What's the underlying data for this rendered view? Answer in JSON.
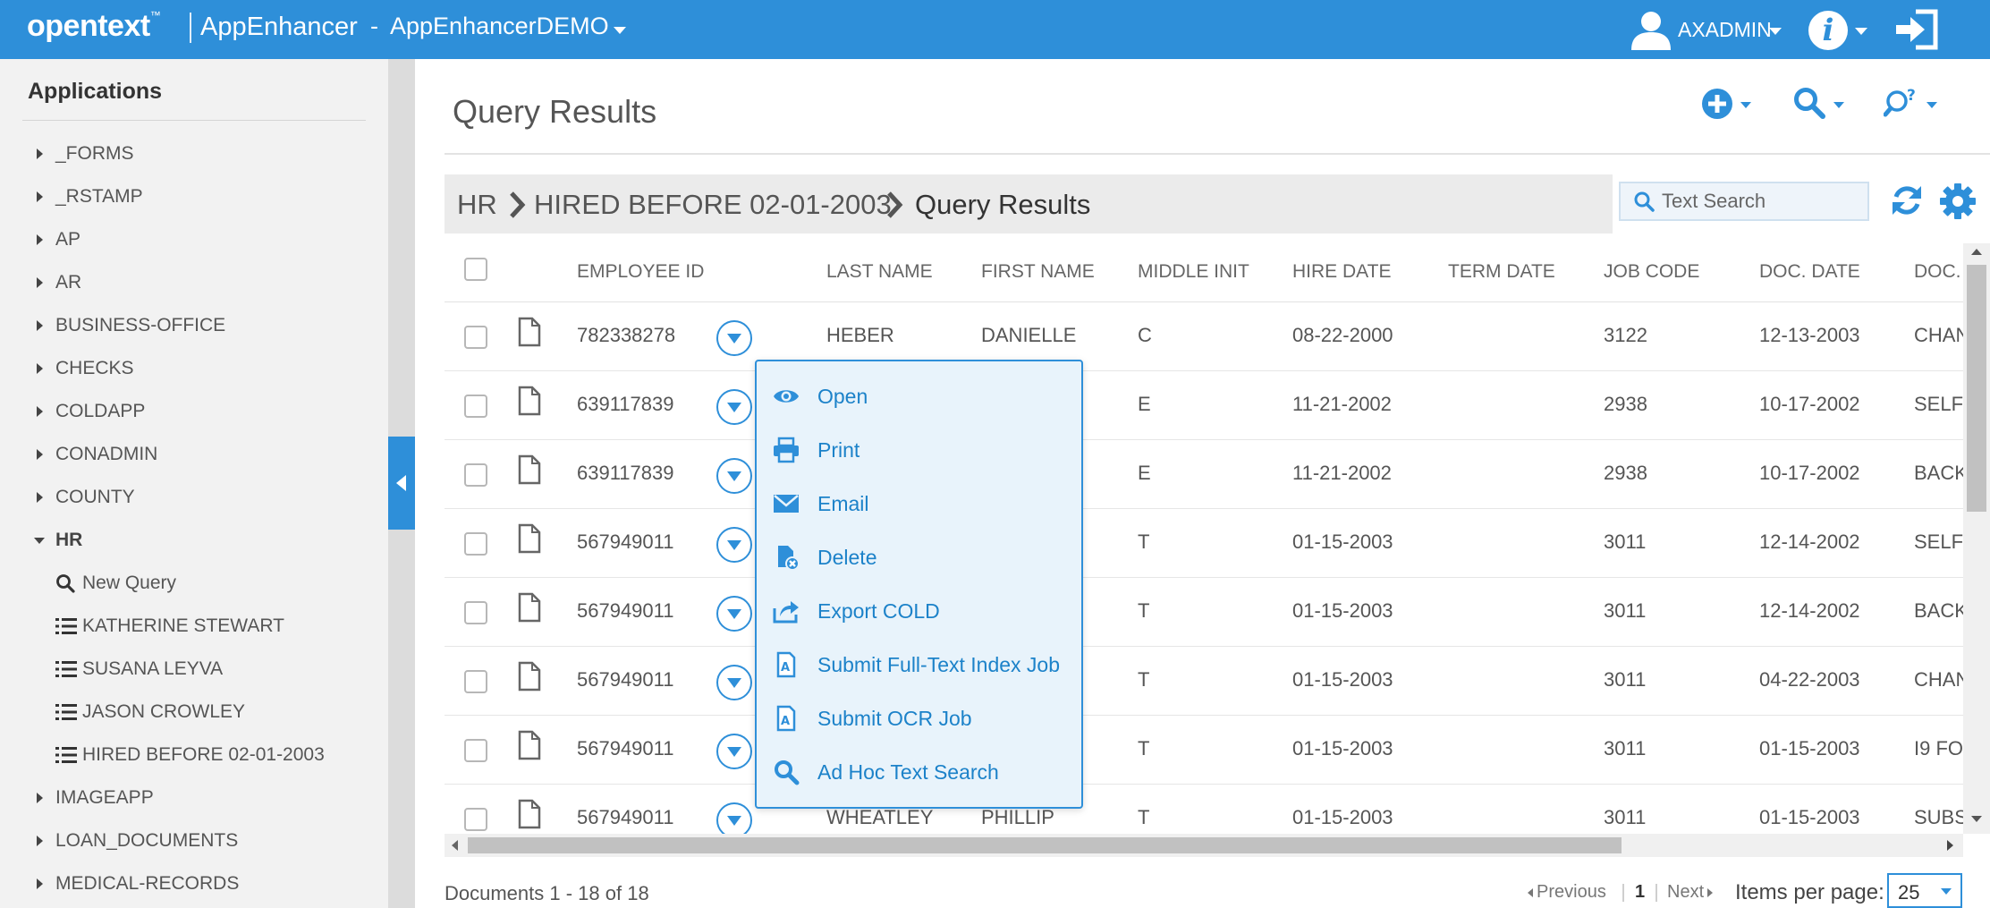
{
  "header": {
    "brand": "opentext",
    "brand_tm": "™",
    "app_name": "AppEnhancer",
    "separator": "-",
    "app_instance": "AppEnhancerDEMO",
    "user_name": "AXADMIN",
    "info_icon_glyph": "i",
    "accent_color": "#2e8fd9"
  },
  "sidebar": {
    "title": "Applications",
    "items": [
      {
        "label": "_FORMS",
        "expanded": false
      },
      {
        "label": "_RSTAMP",
        "expanded": false
      },
      {
        "label": "AP",
        "expanded": false
      },
      {
        "label": "AR",
        "expanded": false
      },
      {
        "label": "BUSINESS-OFFICE",
        "expanded": false
      },
      {
        "label": "CHECKS",
        "expanded": false
      },
      {
        "label": "COLDAPP",
        "expanded": false
      },
      {
        "label": "CONADMIN",
        "expanded": false
      },
      {
        "label": "COUNTY",
        "expanded": false
      },
      {
        "label": "HR",
        "expanded": true
      },
      {
        "label": "IMAGEAPP",
        "expanded": false
      },
      {
        "label": "LOAN_DOCUMENTS",
        "expanded": false
      },
      {
        "label": "MEDICAL-RECORDS",
        "expanded": false
      }
    ],
    "hr_children": [
      {
        "label": "New Query",
        "icon": "search-icon"
      },
      {
        "label": "KATHERINE STEWART",
        "icon": "list-icon"
      },
      {
        "label": "SUSANA LEYVA",
        "icon": "list-icon"
      },
      {
        "label": "JASON CROWLEY",
        "icon": "list-icon"
      },
      {
        "label": "HIRED BEFORE 02-01-2003",
        "icon": "list-icon"
      }
    ]
  },
  "main": {
    "title": "Query Results",
    "breadcrumb": [
      "HR",
      "HIRED BEFORE 02-01-2003",
      "Query Results"
    ],
    "search_placeholder": "Text Search"
  },
  "table": {
    "columns": [
      "EMPLOYEE ID",
      "LAST NAME",
      "FIRST NAME",
      "MIDDLE INIT",
      "HIRE DATE",
      "TERM DATE",
      "JOB CODE",
      "DOC. DATE",
      "DOC."
    ],
    "rows": [
      {
        "employee_id": "782338278",
        "last_name": "HEBER",
        "first_name": "DANIELLE",
        "middle_init": "C",
        "hire_date": "08-22-2000",
        "term_date": "",
        "job_code": "3122",
        "doc_date": "12-13-2003",
        "doc_type": "CHAN"
      },
      {
        "employee_id": "639117839",
        "last_name": "",
        "first_name": "",
        "middle_init": "E",
        "hire_date": "11-21-2002",
        "term_date": "",
        "job_code": "2938",
        "doc_date": "10-17-2002",
        "doc_type": "SELF"
      },
      {
        "employee_id": "639117839",
        "last_name": "",
        "first_name": "",
        "middle_init": "E",
        "hire_date": "11-21-2002",
        "term_date": "",
        "job_code": "2938",
        "doc_date": "10-17-2002",
        "doc_type": "BACK"
      },
      {
        "employee_id": "567949011",
        "last_name": "",
        "first_name": "",
        "middle_init": "T",
        "hire_date": "01-15-2003",
        "term_date": "",
        "job_code": "3011",
        "doc_date": "12-14-2002",
        "doc_type": "SELF"
      },
      {
        "employee_id": "567949011",
        "last_name": "",
        "first_name": "",
        "middle_init": "T",
        "hire_date": "01-15-2003",
        "term_date": "",
        "job_code": "3011",
        "doc_date": "12-14-2002",
        "doc_type": "BACK"
      },
      {
        "employee_id": "567949011",
        "last_name": "",
        "first_name": "",
        "middle_init": "T",
        "hire_date": "01-15-2003",
        "term_date": "",
        "job_code": "3011",
        "doc_date": "04-22-2003",
        "doc_type": "CHAN"
      },
      {
        "employee_id": "567949011",
        "last_name": "",
        "first_name": "",
        "middle_init": "T",
        "hire_date": "01-15-2003",
        "term_date": "",
        "job_code": "3011",
        "doc_date": "01-15-2003",
        "doc_type": "I9 FOI"
      },
      {
        "employee_id": "567949011",
        "last_name": "WHEATLEY",
        "first_name": "PHILLIP",
        "middle_init": "T",
        "hire_date": "01-15-2003",
        "term_date": "",
        "job_code": "3011",
        "doc_date": "01-15-2003",
        "doc_type": "SUBS"
      }
    ]
  },
  "context_menu": {
    "items": [
      {
        "label": "Open",
        "icon": "eye-icon"
      },
      {
        "label": "Print",
        "icon": "printer-icon"
      },
      {
        "label": "Email",
        "icon": "envelope-icon"
      },
      {
        "label": "Delete",
        "icon": "delete-document-icon"
      },
      {
        "label": "Export COLD",
        "icon": "export-icon"
      },
      {
        "label": "Submit Full-Text Index Job",
        "icon": "fulltext-document-icon"
      },
      {
        "label": "Submit OCR Job",
        "icon": "ocr-document-icon"
      },
      {
        "label": "Ad Hoc Text Search",
        "icon": "search-icon"
      }
    ]
  },
  "footer": {
    "document_count": "Documents 1 - 18 of 18",
    "previous_label": "Previous",
    "current_page": "1",
    "next_label": "Next",
    "items_per_page_label": "Items per page:",
    "items_per_page_value": "25"
  }
}
